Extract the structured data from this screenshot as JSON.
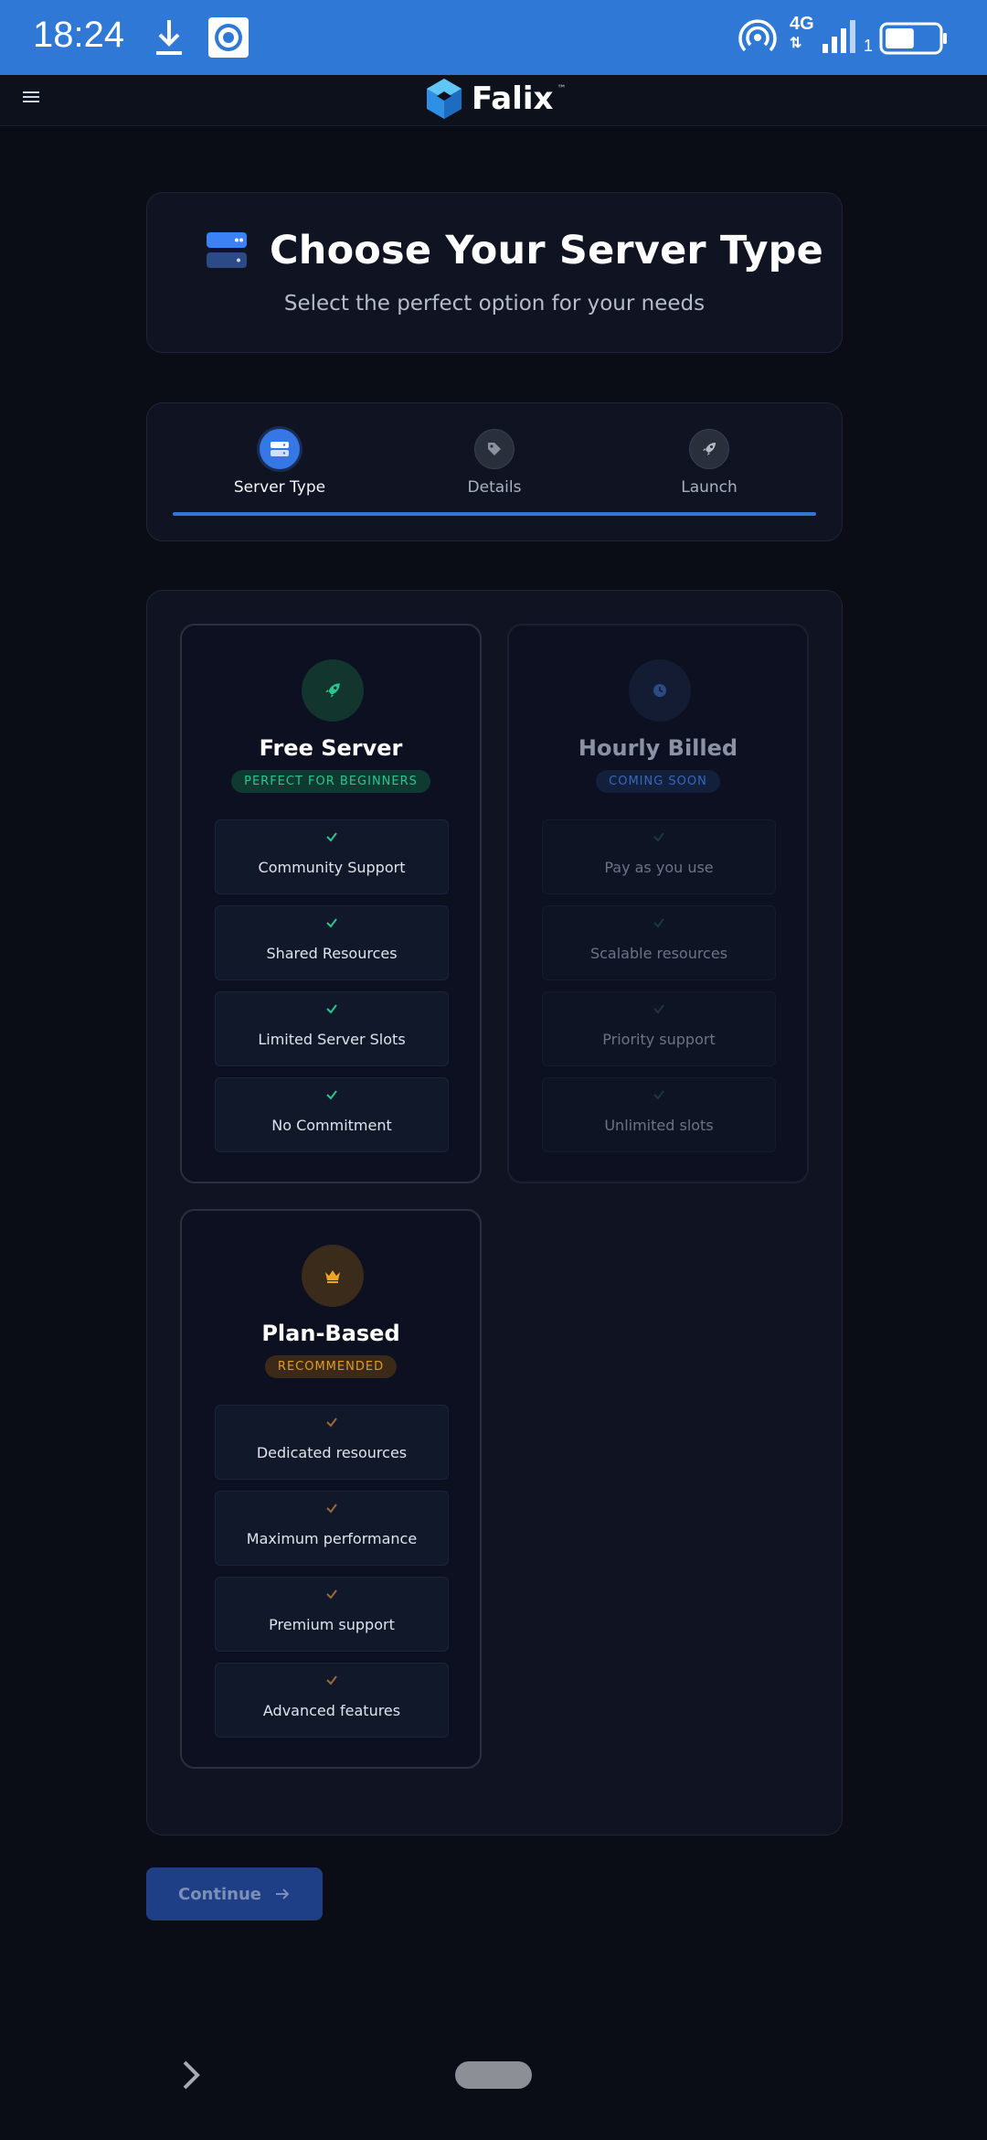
{
  "status_bar": {
    "time": "18:24",
    "network": "4G",
    "sim": "1",
    "icons": [
      "download-icon",
      "screen-record-icon",
      "hotspot-icon",
      "signal-icon",
      "battery-icon"
    ],
    "battery_level": 0.55
  },
  "header": {
    "brand": "Falix",
    "trademark": "™",
    "icons": [
      "menu-icon",
      "falix-logo-icon"
    ]
  },
  "title_card": {
    "title": "Choose Your Server Type",
    "subtitle": "Select the perfect option for your needs",
    "icon": "server-icon"
  },
  "steps": [
    {
      "label": "Server Type",
      "icon": "server-icon",
      "active": true
    },
    {
      "label": "Details",
      "icon": "tag-icon",
      "active": false
    },
    {
      "label": "Launch",
      "icon": "rocket-icon",
      "active": false
    }
  ],
  "progress": 1.0,
  "options": [
    {
      "title": "Free Server",
      "badge": "PERFECT FOR BEGINNERS",
      "icon": "rocket-icon",
      "features": [
        "Community Support",
        "Shared Resources",
        "Limited Server Slots",
        "No Commitment"
      ]
    },
    {
      "title": "Hourly Billed",
      "badge": "COMING SOON",
      "icon": "clock-icon",
      "disabled": true,
      "features": [
        "Pay as you use",
        "Scalable resources",
        "Priority support",
        "Unlimited slots"
      ]
    },
    {
      "title": "Plan-Based",
      "badge": "RECOMMENDED",
      "icon": "crown-icon",
      "features": [
        "Dedicated resources",
        "Maximum performance",
        "Premium support",
        "Advanced features"
      ]
    }
  ],
  "continue_label": "Continue",
  "colors": {
    "accent": "#2f78d6",
    "free": "#2ec48f",
    "hourly": "#3a66b8",
    "plan": "#e49a2a",
    "background": "#0a0c16"
  }
}
